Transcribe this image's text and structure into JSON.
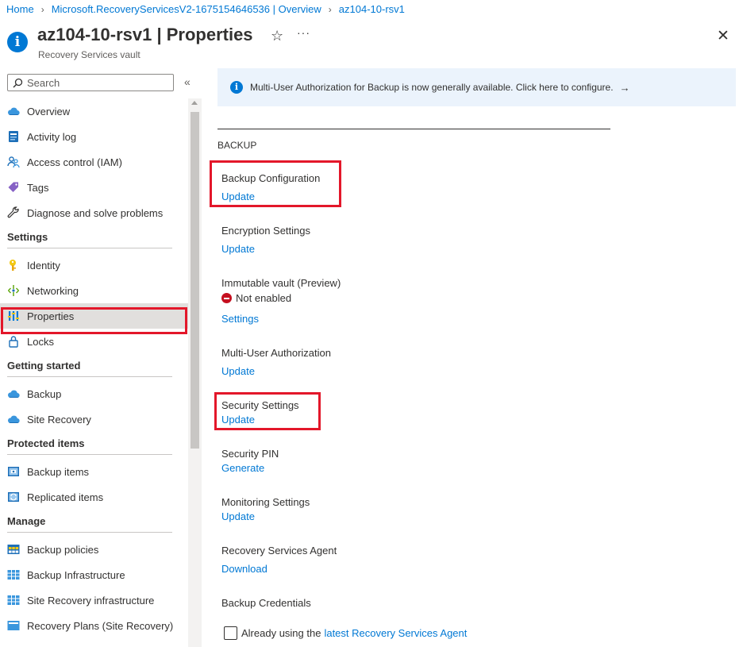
{
  "breadcrumb": [
    {
      "label": "Home"
    },
    {
      "label": "Microsoft.RecoveryServicesV2-1675154646536 | Overview"
    },
    {
      "label": "az104-10-rsv1"
    }
  ],
  "header": {
    "name": "az104-10-rsv1",
    "title_suffix": " | Properties",
    "subtitle": "Recovery Services vault",
    "star_glyph": "☆",
    "more_glyph": "···",
    "close_glyph": "✕"
  },
  "sidebar": {
    "search_placeholder": "Search",
    "collapse_glyph": "«",
    "items": [
      {
        "label": "Overview",
        "icon": "cloud-icon"
      },
      {
        "label": "Activity log",
        "icon": "log-icon"
      },
      {
        "label": "Access control (IAM)",
        "icon": "people-icon"
      },
      {
        "label": "Tags",
        "icon": "tag-icon"
      },
      {
        "label": "Diagnose and solve problems",
        "icon": "wrench-icon"
      }
    ],
    "groups": [
      {
        "title": "Settings",
        "items": [
          {
            "label": "Identity",
            "icon": "key-icon"
          },
          {
            "label": "Networking",
            "icon": "network-icon"
          },
          {
            "label": "Properties",
            "icon": "properties-icon",
            "active": true
          },
          {
            "label": "Locks",
            "icon": "lock-icon"
          }
        ]
      },
      {
        "title": "Getting started",
        "items": [
          {
            "label": "Backup",
            "icon": "cloud-icon"
          },
          {
            "label": "Site Recovery",
            "icon": "cloud-icon"
          }
        ]
      },
      {
        "title": "Protected items",
        "items": [
          {
            "label": "Backup items",
            "icon": "backup-items-icon"
          },
          {
            "label": "Replicated items",
            "icon": "replicated-items-icon"
          }
        ]
      },
      {
        "title": "Manage",
        "items": [
          {
            "label": "Backup policies",
            "icon": "policy-grid-icon"
          },
          {
            "label": "Backup Infrastructure",
            "icon": "infrastructure-grid-icon"
          },
          {
            "label": "Site Recovery infrastructure",
            "icon": "infrastructure-grid-icon"
          },
          {
            "label": "Recovery Plans (Site Recovery)",
            "icon": "plans-icon"
          }
        ]
      }
    ]
  },
  "banner": {
    "text": "Multi-User Authorization for Backup is now generally available. Click here to configure.",
    "info_glyph": "i",
    "arrow_glyph": "→"
  },
  "main": {
    "section": "BACKUP",
    "properties": [
      {
        "label": "Backup Configuration",
        "link": "Update"
      },
      {
        "label": "Encryption Settings",
        "link": "Update"
      },
      {
        "label": "Immutable vault (Preview)",
        "status": "Not enabled",
        "link": "Settings"
      },
      {
        "label": "Multi-User Authorization",
        "link": "Update"
      },
      {
        "label": "Security Settings",
        "link": "Update"
      },
      {
        "label": "Security PIN",
        "link": "Generate"
      },
      {
        "label": "Monitoring Settings",
        "link": "Update"
      },
      {
        "label": "Recovery Services Agent",
        "link": "Download"
      },
      {
        "label": "Backup Credentials"
      }
    ],
    "checkbox": {
      "label": "Already using the",
      "link": "latest Recovery Services Agent",
      "checked": false
    }
  },
  "colors": {
    "accent": "#0078d4",
    "highlight_box": "#e3172a",
    "banner_bg": "#ebf3fc",
    "status_error": "#c50f1f"
  }
}
